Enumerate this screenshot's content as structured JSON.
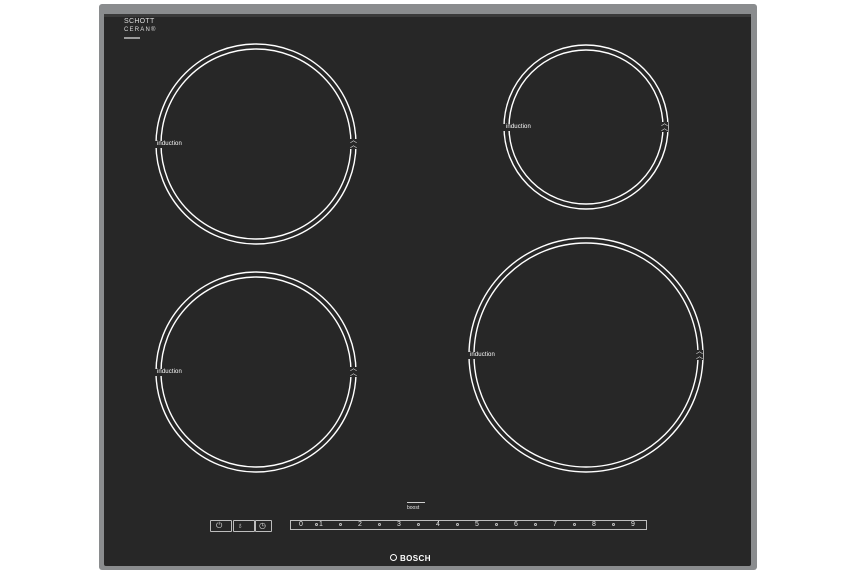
{
  "brand": {
    "glass_logo_line1": "SCHOTT",
    "glass_logo_line2": "CERAN®",
    "manufacturer": "BOSCH"
  },
  "zones": [
    {
      "id": "front-left",
      "label": "induction"
    },
    {
      "id": "rear-left",
      "label": "induction"
    },
    {
      "id": "rear-right",
      "label": "induction"
    },
    {
      "id": "front-right",
      "label": "induction"
    }
  ],
  "controls": {
    "boost_label": "boost",
    "power_levels": [
      "0",
      "1",
      "2",
      "3",
      "4",
      "5",
      "6",
      "7",
      "8",
      "9"
    ],
    "left_icons": [
      "power-icon",
      "lock-icon",
      "timer-icon"
    ]
  },
  "colors": {
    "glass": "#272727",
    "frame": "#8a8c8e",
    "ring": "#ffffff"
  }
}
